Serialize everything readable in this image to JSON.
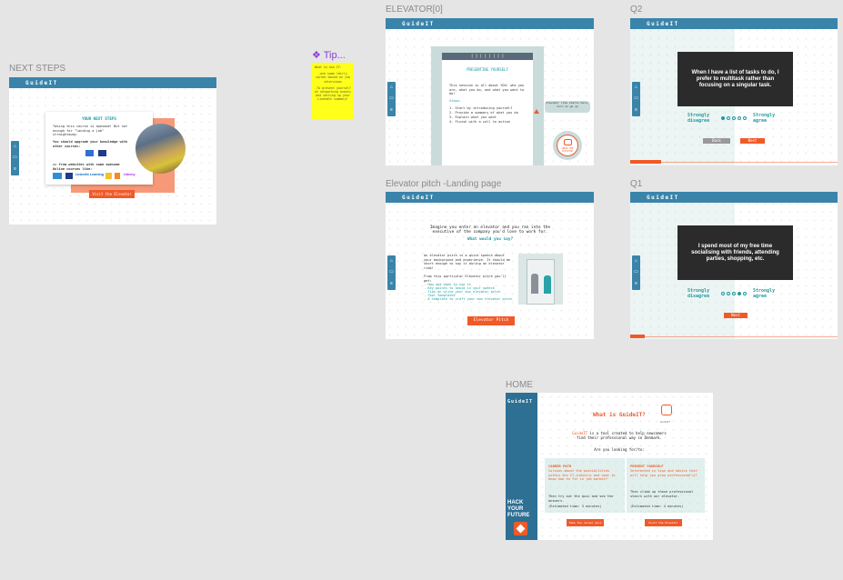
{
  "frames": {
    "next_steps": {
      "label": "NEXT STEPS",
      "brand": "GuideIT",
      "card_title": "YOUR NEXT STEPS",
      "intro": "Taking this course is awesome! But not enough for \"landing a job\" straightaway.",
      "upgrade": "You should upgrade your knowledge with other courses:",
      "free_sites": ">> from websites with some awesome Online courses like:",
      "logos": [
        "LinkedIn Learning",
        "Udemy"
      ],
      "button": "Visit the Elevator"
    },
    "tip": {
      "label": "❖ Tip...",
      "note_lines": [
        "What to ask IT:",
        "-ask some fairly career-based on job interviews",
        "-To present yourself at networking events and setting up your LinkedIn summary!"
      ]
    },
    "elevator0": {
      "label": "ELEVATOR[0]",
      "brand": "GuideIT",
      "panel_header": "[ ] [ ] [ ] [ ]",
      "subtitle": "PRESENTING YOURSELF",
      "body": "This session is all about YOU: who you are, what you do, and what you want to do!",
      "steps_title": "Steps:",
      "steps": [
        "1. Start by introducing yourself",
        "2. Provide a summary of what you do",
        "3. Explain what you want",
        "4. Finish with a call to action"
      ],
      "tooltip": "Elevator ride starts here, turn to go up",
      "badge": "ABOUT THE ELEVATOR"
    },
    "q2": {
      "label": "Q2",
      "brand": "GuideIT",
      "statement": "When I have a list of tasks to do, I prefer to multitask rather than focusing on a singular task.",
      "left": "Strongly disagree",
      "right": "Strongly agree",
      "selected": 0,
      "back": "Back",
      "next": "Next",
      "progress": 0.15
    },
    "landing": {
      "label": "Elevator pitch -Landing page",
      "brand": "GuideIT",
      "headline": "Imagine you enter an elevator and you ran into the executive of the company you'd love to work for.",
      "question": "What would you say?",
      "definition": "An elevator pitch is a quick speech about your background and experience. It should be short enough to say it during an elevator ride!",
      "learn_intro": "From this particular Elevator pitch you'll get:",
      "learn_list": [
        "- How and when to use it",
        "- Key points to avoid in your speech",
        "- Tips on write your own elevator pitch",
        "- Tool templates",
        "- A template to craft your own elevator pitch"
      ],
      "button": "Elevator Pitch"
    },
    "q1": {
      "label": "Q1",
      "brand": "GuideIT",
      "statement": "I spend most of my free time socialising with friends, attending parties, shopping, etc.",
      "left": "Strongly disagree",
      "right": "Strongly agree",
      "selected": 3,
      "next": "Next",
      "progress": 0.07
    },
    "home": {
      "label": "HOME",
      "brand": "GuideIT",
      "title": "What is GuideIT?",
      "mascot_caption": "GuideIT",
      "intro_brand": "GuideIT",
      "intro_rest": " is a tool created to help newcomers find their professional way in Denmark.",
      "looking": "Are you looking for/to:",
      "career": {
        "title": "CAREER PATH",
        "text": "Curious about the possibilities within the IT-industry and want to know how to fit in job market?",
        "then": "Then try out the quiz and see the answers.",
        "time": "(Estimated time: 3 minutes)",
        "button": "Take the career quiz"
      },
      "present": {
        "title": "PRESENT YOURSELF",
        "text": "Interested in tips and advice that will help you grow professionally?",
        "then": "Then climb up those professional stairs with our elevator.",
        "time": "(Estimated time: 4 minutes)",
        "button": "Visit the Elevator"
      },
      "hyf_logo": [
        "HACK",
        "YOUR",
        "FUTURE"
      ]
    }
  },
  "colors": {
    "brand_blue": "#3a84aa",
    "accent_orange": "#f05a28",
    "teal": "#1f9aa0",
    "sticky": "#ffff1a"
  },
  "icons": [
    "home-icon",
    "laptop-icon",
    "list-icon"
  ]
}
